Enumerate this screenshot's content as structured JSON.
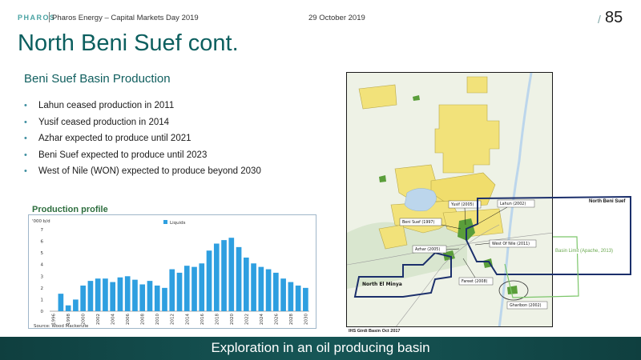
{
  "header": {
    "logo": "PHAROS",
    "company": "Pharos Energy – Capital Markets Day 2019",
    "date": "29 October 2019",
    "page_number": "85"
  },
  "title": "North Beni Suef cont.",
  "subtitle": "Beni Suef Basin Production",
  "bullets": [
    "Lahun ceased production in 2011",
    "Yusif ceased production in 2014",
    "Azhar expected to produce until 2021",
    "Beni Suef expected to produce until 2023",
    "West of Nile (WON) expected to produce beyond 2030"
  ],
  "production_profile_title": "Production profile",
  "chart_data": {
    "type": "bar",
    "ylabel": "'000 b/d",
    "legend": "Liquids",
    "legend_position": "top",
    "source": "Source: Wood Mackenzie",
    "ylim": [
      0,
      7
    ],
    "yticks": [
      0,
      1,
      2,
      3,
      4,
      5,
      6,
      7
    ],
    "xtick_labels": [
      "1996",
      "1998",
      "2000",
      "2002",
      "2004",
      "2006",
      "2008",
      "2010",
      "2012",
      "2014",
      "2016",
      "2018",
      "2020",
      "2022",
      "2024",
      "2026",
      "2028",
      "2030"
    ],
    "x": [
      1997,
      1998,
      1999,
      2000,
      2001,
      2002,
      2003,
      2004,
      2005,
      2006,
      2007,
      2008,
      2009,
      2010,
      2011,
      2012,
      2013,
      2014,
      2015,
      2016,
      2017,
      2018,
      2019,
      2020,
      2021,
      2022,
      2023,
      2024,
      2025,
      2026,
      2027,
      2028,
      2029,
      2030
    ],
    "values": [
      1.5,
      0.5,
      1.0,
      2.2,
      2.6,
      2.8,
      2.8,
      2.5,
      2.9,
      3.0,
      2.7,
      2.3,
      2.6,
      2.2,
      2.0,
      3.6,
      3.3,
      3.9,
      3.8,
      4.1,
      5.2,
      5.8,
      6.1,
      6.3,
      5.5,
      4.6,
      4.1,
      3.8,
      3.6,
      3.3,
      2.8,
      2.5,
      2.2,
      2.0,
      1.8,
      1.6,
      1.3,
      1.1,
      1.0
    ]
  },
  "map": {
    "source": "IHS Girdi Basin Oct 2017",
    "labels": {
      "yusif": "Yusif (2005)",
      "lahun": "Lahun (2002)",
      "beni_suef": "Beni Suef (1997)",
      "west_of_nile": "West Of Nile (2011)",
      "azhar": "Azhar (2005)",
      "fareet": "Fareet (2008)",
      "gharibon": "Gharibon (2002)",
      "north_el_minya": "North El Minya",
      "north_beni_suef": "North Beni Suef",
      "basin_limit": "Basin Limit (Apache, 2013)"
    },
    "colors": {
      "block": "#f2e27a",
      "field": "#5a9e3a",
      "licence_outline": "#1b2f6b",
      "basin_limit": "#7cc66a"
    }
  },
  "footer": "Exploration in an oil producing basin"
}
